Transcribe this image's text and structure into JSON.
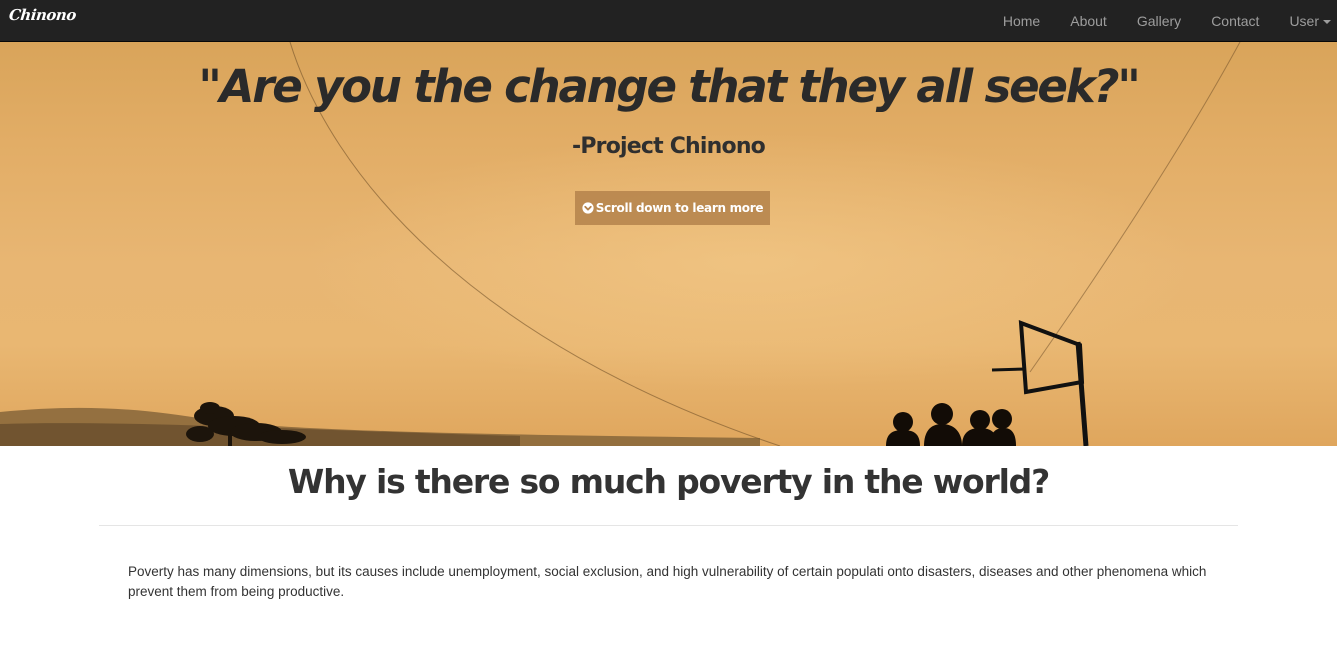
{
  "navbar": {
    "brand": "Chinono",
    "links": {
      "home": "Home",
      "about": "About",
      "gallery": "Gallery",
      "contact": "Contact",
      "user": "User"
    },
    "colors": {
      "background": "#222222",
      "link": "#9d9d9d"
    }
  },
  "hero": {
    "quote": "\"Are you the change that they all seek?\"",
    "attribution": "-Project Chinono",
    "button_label": "Scroll down to learn more",
    "button_icon": "chevron-circle-down-icon",
    "colors": {
      "sky": "#e8b673",
      "button": "#b4824b"
    }
  },
  "section": {
    "title": "Why is there so much poverty in the world?",
    "body": "Poverty has many dimensions, but its causes include unemployment, social exclusion, and high vulnerability of certain populati onto disasters, diseases and other phenomena which prevent them from being productive."
  }
}
